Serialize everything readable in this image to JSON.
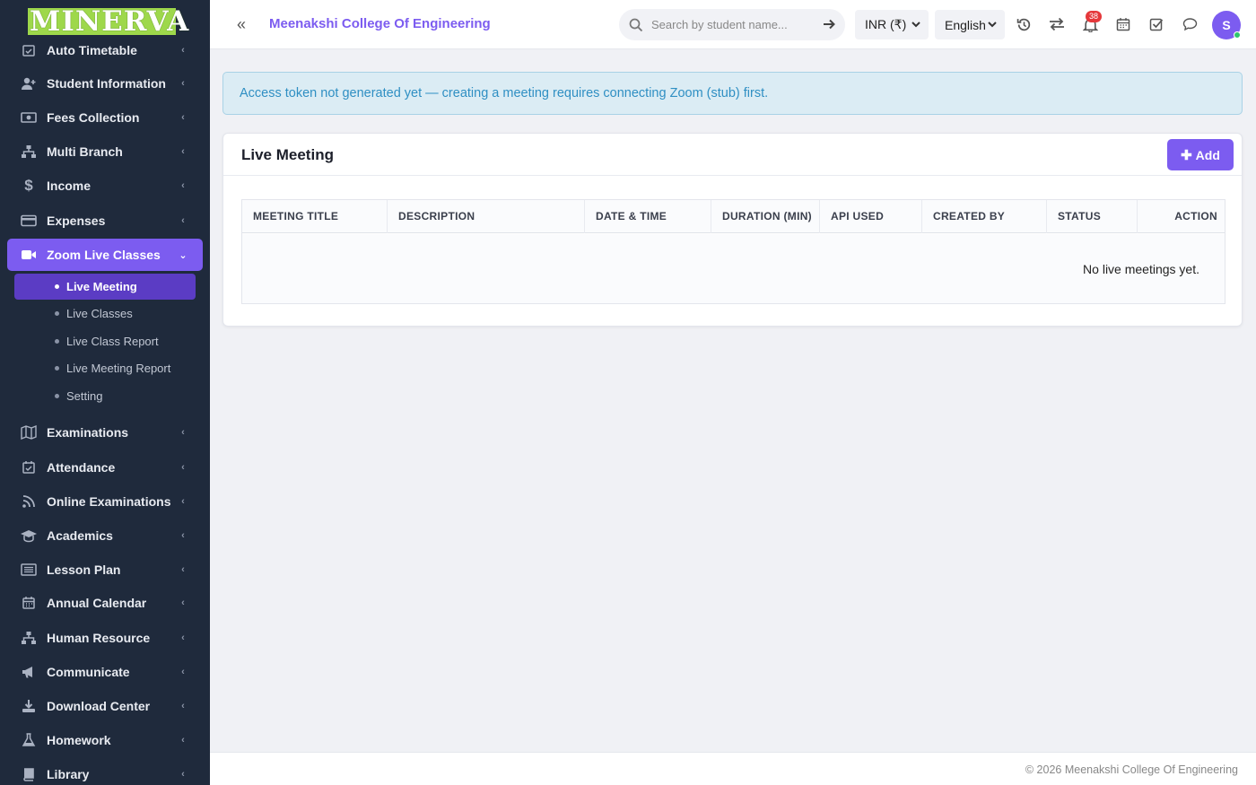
{
  "brand": {
    "logo_text": "MINERVA"
  },
  "sidebar": {
    "items_top": [
      {
        "label": "Auto Timetable",
        "icon": "calendar-check-icon"
      },
      {
        "label": "Student Information",
        "icon": "user-plus-icon"
      },
      {
        "label": "Fees Collection",
        "icon": "money-icon"
      },
      {
        "label": "Multi Branch",
        "icon": "sitemap-icon"
      },
      {
        "label": "Income",
        "icon": "dollar-icon"
      },
      {
        "label": "Expenses",
        "icon": "credit-card-icon"
      },
      {
        "label": "Zoom Live Classes",
        "icon": "video-icon"
      }
    ],
    "submenu": [
      {
        "label": "Live Meeting"
      },
      {
        "label": "Live Classes"
      },
      {
        "label": "Live Class Report"
      },
      {
        "label": "Live Meeting Report"
      },
      {
        "label": "Setting"
      }
    ],
    "items_bottom": [
      {
        "label": "Examinations",
        "icon": "map-icon"
      },
      {
        "label": "Attendance",
        "icon": "calendar-check-icon"
      },
      {
        "label": "Online Examinations",
        "icon": "rss-icon"
      },
      {
        "label": "Academics",
        "icon": "graduation-cap-icon"
      },
      {
        "label": "Lesson Plan",
        "icon": "list-icon"
      },
      {
        "label": "Annual Calendar",
        "icon": "calendar-icon"
      },
      {
        "label": "Human Resource",
        "icon": "sitemap-icon"
      },
      {
        "label": "Communicate",
        "icon": "bullhorn-icon"
      },
      {
        "label": "Download Center",
        "icon": "download-icon"
      },
      {
        "label": "Homework",
        "icon": "flask-icon"
      },
      {
        "label": "Library",
        "icon": "book-icon"
      }
    ]
  },
  "header": {
    "college_name": "Meenakshi College Of Engineering",
    "search_placeholder": "Search by student name...",
    "currency": "INR (₹)",
    "language": "English",
    "notification_count": "38",
    "avatar_initial": "S"
  },
  "alert": {
    "message": "Access token not generated yet — creating a meeting requires connecting Zoom (stub) first."
  },
  "card": {
    "title": "Live Meeting",
    "add_label": "Add",
    "columns": [
      "MEETING TITLE",
      "DESCRIPTION",
      "DATE & TIME",
      "DURATION (MIN)",
      "API USED",
      "CREATED BY",
      "STATUS",
      "ACTION"
    ],
    "empty_message": "No live meetings yet."
  },
  "footer": {
    "text": "© 2026 Meenakshi College Of Engineering"
  },
  "colors": {
    "accent": "#7c5cf0",
    "sidebar_bg": "#1f2a3c",
    "alert_text": "#2f8fc3",
    "badge": "#e5383b",
    "logo_bg": "#9ed84b"
  }
}
